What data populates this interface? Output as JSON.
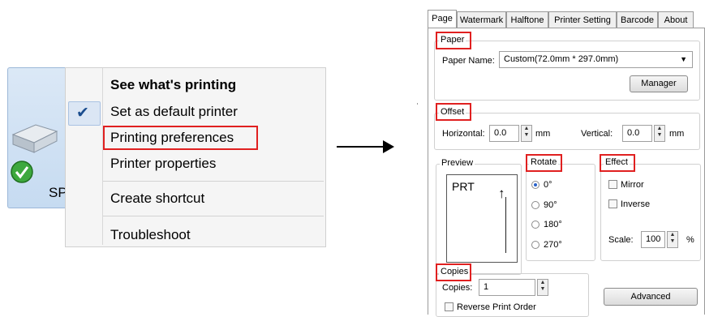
{
  "context_menu": {
    "printer_label": "SP",
    "items": [
      {
        "label": "See what's printing",
        "bold": true
      },
      {
        "label": "Set as default printer",
        "checked": true
      },
      {
        "label": "Printing preferences",
        "highlighted": true
      },
      {
        "label": "Printer properties"
      },
      {
        "label": "Create shortcut"
      },
      {
        "label": "Troubleshoot"
      }
    ],
    "check_icon": "checkmark-icon",
    "highlight_color": "#e02020"
  },
  "dialog": {
    "tabs": [
      "Page",
      "Watermark",
      "Halftone",
      "Printer Setting",
      "Barcode",
      "About"
    ],
    "active_tab": "Page",
    "paper": {
      "legend": "Paper",
      "name_label": "Paper Name:",
      "name_value": "Custom(72.0mm * 297.0mm)",
      "manager_button": "Manager"
    },
    "offset": {
      "legend": "Offset",
      "horizontal_label": "Horizontal:",
      "horizontal_value": "0.0",
      "horizontal_unit": "mm",
      "vertical_label": "Vertical:",
      "vertical_value": "0.0",
      "vertical_unit": "mm"
    },
    "preview": {
      "legend": "Preview",
      "sample_text": "PRT"
    },
    "rotate": {
      "legend": "Rotate",
      "options": [
        "0°",
        "90°",
        "180°",
        "270°"
      ],
      "selected": "0°"
    },
    "effect": {
      "legend": "Effect",
      "mirror_label": "Mirror",
      "inverse_label": "Inverse",
      "scale_label": "Scale:",
      "scale_value": "100",
      "scale_unit": "%"
    },
    "copies": {
      "legend": "Copies",
      "copies_label": "Copies:",
      "copies_value": "1",
      "reverse_label": "Reverse Print Order"
    },
    "advanced_button": "Advanced"
  }
}
